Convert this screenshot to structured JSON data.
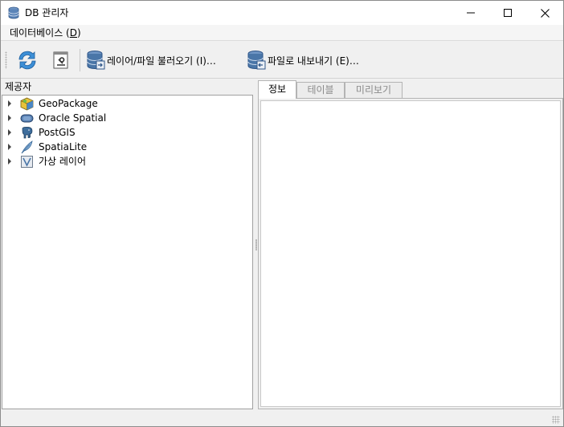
{
  "window": {
    "title": "DB 관리자"
  },
  "menubar": {
    "items": [
      {
        "label": "데이터베이스 (",
        "mnemonic": "D",
        "suffix": ")"
      }
    ]
  },
  "toolbar": {
    "import_label": "레이어/파일 불러오기 (I)…",
    "export_label": "파일로 내보내기 (E)…"
  },
  "providers": {
    "title": "제공자",
    "items": [
      {
        "label": "GeoPackage",
        "icon": "geopackage-icon"
      },
      {
        "label": "Oracle Spatial",
        "icon": "oracle-icon"
      },
      {
        "label": "PostGIS",
        "icon": "postgis-elephant-icon"
      },
      {
        "label": "SpatiaLite",
        "icon": "spatialite-feather-icon"
      },
      {
        "label": "가상 레이어",
        "icon": "virtual-layer-icon"
      }
    ]
  },
  "tabs": [
    {
      "label": "정보",
      "active": true
    },
    {
      "label": "테이블",
      "active": false
    },
    {
      "label": "미리보기",
      "active": false
    }
  ],
  "colors": {
    "accent_blue": "#3d8fd6",
    "db_blue": "#4a76a8"
  }
}
